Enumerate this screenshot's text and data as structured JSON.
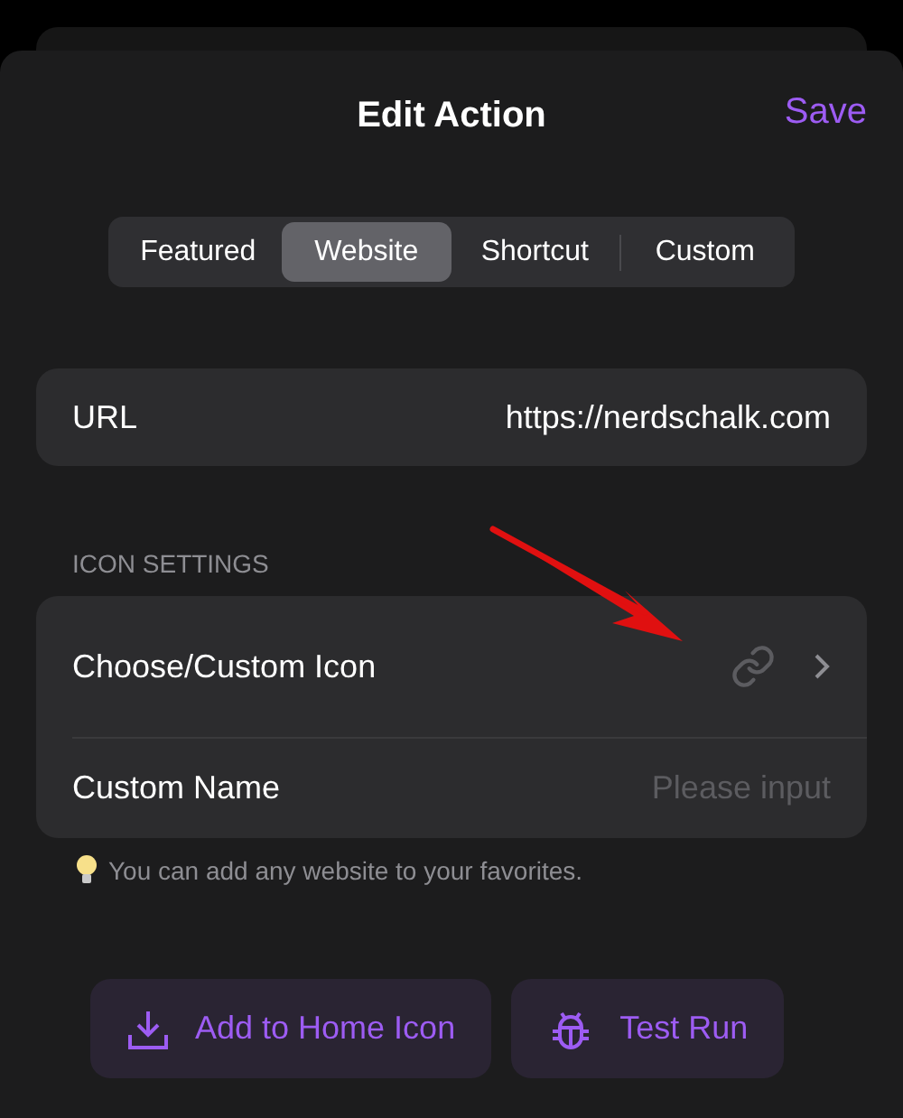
{
  "header": {
    "title": "Edit Action",
    "save": "Save"
  },
  "tabs": [
    {
      "label": "Featured",
      "selected": false
    },
    {
      "label": "Website",
      "selected": true
    },
    {
      "label": "Shortcut",
      "selected": false
    },
    {
      "label": "Custom",
      "selected": false
    }
  ],
  "url": {
    "label": "URL",
    "value": "https://nerdschalk.com"
  },
  "icon_settings": {
    "heading": "ICON SETTINGS",
    "choose_label": "Choose/Custom Icon",
    "name_label": "Custom Name",
    "name_placeholder": "Please input"
  },
  "hint": "You can add any website to your favorites.",
  "buttons": [
    {
      "kind": "download",
      "label": "Add to Home Icon"
    },
    {
      "kind": "bug",
      "label": "Test Run"
    }
  ]
}
